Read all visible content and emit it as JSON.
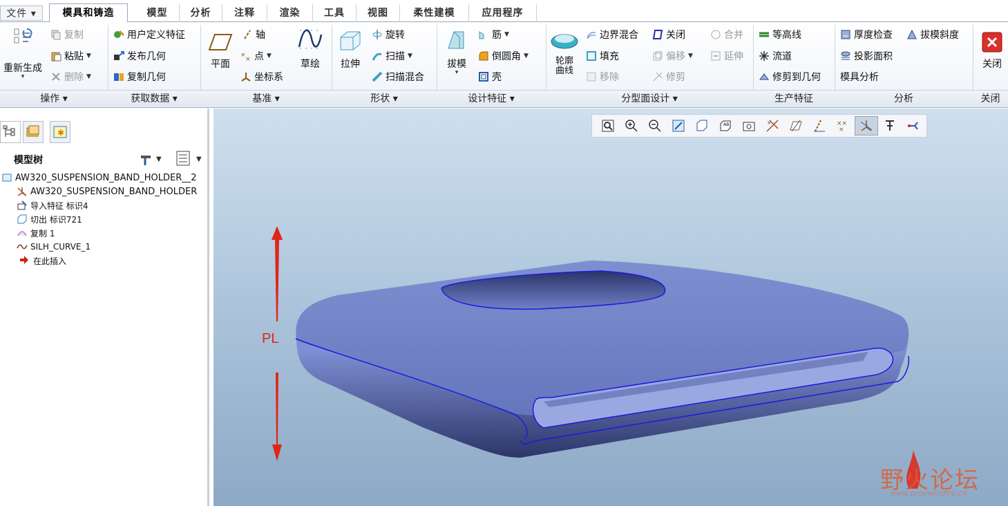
{
  "tabs": [
    {
      "label": "文件 ▾"
    },
    {
      "label": "模具和铸造"
    },
    {
      "label": "模型"
    },
    {
      "label": "分析"
    },
    {
      "label": "注释"
    },
    {
      "label": "渲染"
    },
    {
      "label": "工具"
    },
    {
      "label": "视图"
    },
    {
      "label": "柔性建模"
    },
    {
      "label": "应用程序"
    }
  ],
  "ribbon": {
    "operations": {
      "regen": "重新生成",
      "copy": "复制",
      "paste": "粘贴",
      "delete": "删除",
      "group": "操作 ▾"
    },
    "getdata": {
      "udf": "用户定义特征",
      "publish": "发布几何",
      "copygeom": "复制几何",
      "group": "获取数据 ▾"
    },
    "datum": {
      "plane": "平面",
      "axis": "轴",
      "point": "点",
      "csys": "坐标系",
      "sketch": "草绘",
      "group": "基准 ▾"
    },
    "shape": {
      "extrude": "拉伸",
      "revolve": "旋转",
      "sweep": "扫描",
      "sweepblend": "扫描混合",
      "group": "形状 ▾"
    },
    "engfeat": {
      "draft": "拔模",
      "rib": "筋",
      "round": "倒圆角",
      "shell": "壳",
      "group": "设计特征 ▾"
    },
    "parting": {
      "silhouette": "轮廓曲线",
      "boundary": "边界混合",
      "fill": "填充",
      "move": "移除",
      "close": "关闭",
      "offset": "偏移",
      "trim": "修剪",
      "merge": "合并",
      "extend": "延伸",
      "group": "分型面设计 ▾"
    },
    "production": {
      "contour": "等高线",
      "runner": "流道",
      "trimgeom": "修剪到几何",
      "group": "生产特征"
    },
    "analysis": {
      "thickness": "厚度检查",
      "draftcheck": "拔模斜度",
      "projarea": "投影面积",
      "mold": "模具分析",
      "group": "分析"
    },
    "close": {
      "label": "关闭",
      "group": "关闭"
    }
  },
  "tree": {
    "title": "模型树",
    "items": [
      "AW320_SUSPENSION_BAND_HOLDER__2",
      "AW320_SUSPENSION_BAND_HOLDER",
      "导入特征 标识4",
      "切出 标识721",
      "复制 1",
      "SILH_CURVE_1",
      "在此插入"
    ]
  },
  "viewport": {
    "annotation": "PL"
  },
  "watermark": {
    "text": "野火论坛",
    "url": "www.proewildfire.cn"
  },
  "colors": {
    "accent": "#2a5aa8",
    "part": "#6f7fc0",
    "arrow": "#e02418",
    "edge": "#1a1adf"
  }
}
